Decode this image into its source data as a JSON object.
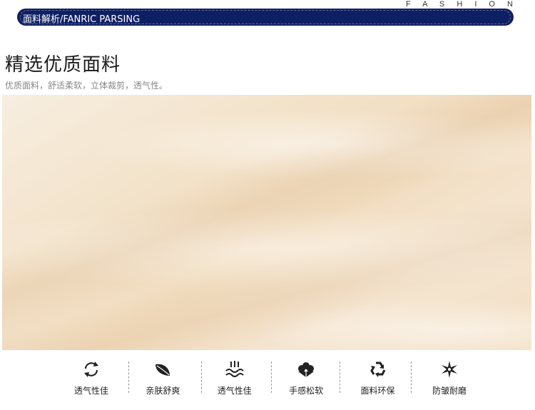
{
  "header": {
    "fashion_label": "F A S H I O N",
    "banner_title": "面料解析/FANRIC PARSING"
  },
  "main": {
    "title": "精选优质面料",
    "subtitle": "优质面料，舒适柔软，立体裁剪，透气性。"
  },
  "features": [
    {
      "icon": "recycle-arrows-icon",
      "label": "透气性佳"
    },
    {
      "icon": "leaf-icon",
      "label": "亲肤舒爽"
    },
    {
      "icon": "wave-breathable-icon",
      "label": "透气性佳"
    },
    {
      "icon": "cotton-flower-icon",
      "label": "手感松软"
    },
    {
      "icon": "recycle-triangle-icon",
      "label": "面料环保"
    },
    {
      "icon": "star-icon",
      "label": "防皱耐磨"
    }
  ],
  "colors": {
    "banner": "#0f1f63",
    "fabric": "#f3e3cb"
  }
}
